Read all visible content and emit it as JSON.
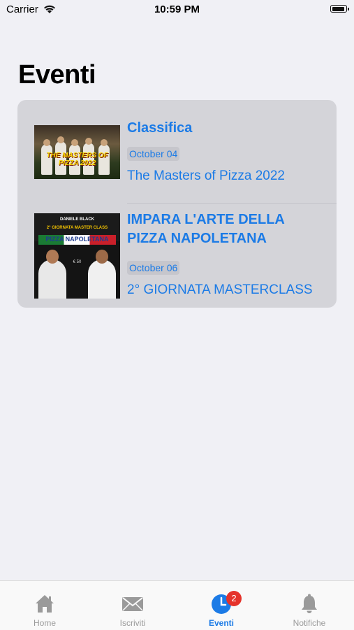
{
  "status_bar": {
    "carrier": "Carrier",
    "time": "10:59 PM"
  },
  "page": {
    "title": "Eventi"
  },
  "events": [
    {
      "title": "Classifica",
      "date": "October 04",
      "subtitle": "The Masters of Pizza 2022",
      "image_text": "THE MASTERS OF PIZZA 2022"
    },
    {
      "title_line1": "IMPARA L'ARTE DELLA",
      "title_line2": "PIZZA NAPOLETANA",
      "date": "October 06",
      "subtitle": "2° GIORNATA MASTERCLASS",
      "image_text": {
        "brand": "DANIELE BLACK",
        "heading": "2° GIORNATA MASTER CLASS",
        "band": "PIZZA NAPOLETANA",
        "price": "€ 50"
      }
    }
  ],
  "tab_bar": {
    "tabs": [
      {
        "label": "Home",
        "icon": "house-icon",
        "active": false
      },
      {
        "label": "Iscriviti",
        "icon": "envelope-icon",
        "active": false
      },
      {
        "label": "Eventi",
        "icon": "clock-icon",
        "active": true,
        "badge": "2"
      },
      {
        "label": "Notifiche",
        "icon": "bell-icon",
        "active": false
      }
    ]
  },
  "colors": {
    "accent": "#1c7be6",
    "badge": "#e5332b",
    "background": "#f0f0f5",
    "card": "#d4d4d9"
  }
}
